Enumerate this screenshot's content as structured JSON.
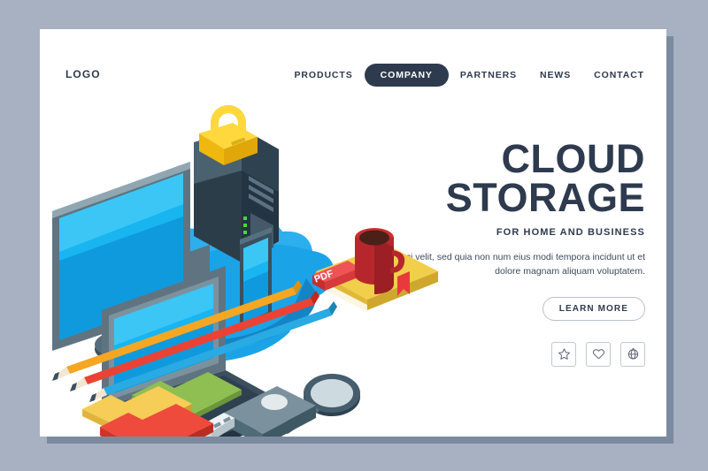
{
  "page": {
    "background_color": "#a7b1c1",
    "card_color": "#ffffff",
    "shadow_color": "#7b8a9e",
    "accent_dark": "#2e3a4e"
  },
  "header": {
    "logo": "LOGO",
    "nav": [
      {
        "label": "PRODUCTS",
        "active": false
      },
      {
        "label": "COMPANY",
        "active": true
      },
      {
        "label": "PARTNERS",
        "active": false
      },
      {
        "label": "NEWS",
        "active": false
      },
      {
        "label": "CONTACT",
        "active": false
      }
    ]
  },
  "hero": {
    "title_line1": "CLOUD",
    "title_line2": "STORAGE",
    "subtitle": "FOR HOME AND BUSINESS",
    "paragraph": "Adipisci velit, sed quia non num eius modi tempora incidunt ut et dolore magnam aliquam voluptatem.",
    "cta_label": "LEARN MORE",
    "social_icons": [
      {
        "name": "star-icon",
        "glyph": "☆"
      },
      {
        "name": "heart-icon",
        "glyph": "♡"
      },
      {
        "name": "globe-icon",
        "glyph": "⊕"
      }
    ]
  },
  "illustration": {
    "description": "Isometric cloud storage workspace",
    "cloud_platform_color": "#1ba3e8",
    "cloud_platform_color_dark": "#1583c4",
    "screen_color": "#18b5f0",
    "device_body_color": "#3b4f5e",
    "padlock_color": "#f7c417",
    "pdf_tag_label": "PDF",
    "pdf_tag_color": "#e8393c",
    "book_color": "#f2cf4a",
    "mug_color": "#b5272d",
    "folders": [
      "#7fb648",
      "#f4c84a",
      "#ea4335"
    ],
    "pencils": [
      "#f5a623",
      "#ea4335",
      "#29aae2"
    ],
    "usb_color": "#5b7f8c",
    "led_color": "#46d93a",
    "items": [
      "desktop-monitor",
      "laptop",
      "tablet",
      "server-tower",
      "padlock",
      "mouse",
      "book",
      "coffee-mug",
      "pdf-tag",
      "pencils",
      "magnifier",
      "usb-drive",
      "folders"
    ]
  }
}
